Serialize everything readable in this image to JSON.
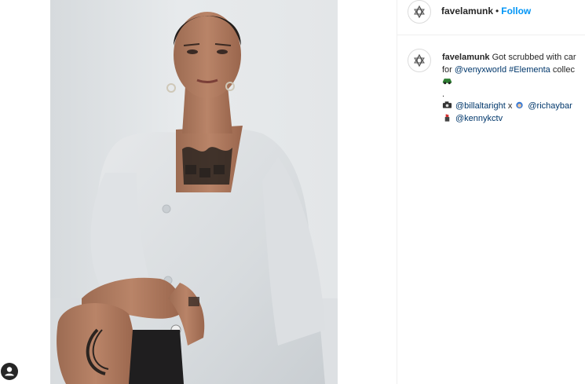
{
  "post": {
    "username": "favelamunk",
    "separator": "•",
    "follow_label": "Follow",
    "caption": {
      "username": "favelamunk",
      "line1_text": "Got scrubbed with car",
      "line2_prefix": "for",
      "line2_mention": "@venyxworld",
      "line2_hashtag": "#Elementa",
      "line2_suffix": "collec",
      "line4_dot": ".",
      "credit1_mention": "@billaltaright",
      "credit1_x": "x",
      "credit2_mention": "@richaybar",
      "credit3_mention": "@kennykctv"
    },
    "icons": {
      "avatar_logo": "lotus-logo-icon",
      "row3": "car-emoji-icon",
      "credit1": "camera-emoji-icon",
      "credit2": "hair-emoji-icon",
      "credit3": "lipstick-emoji-icon",
      "profile": "profile-icon"
    }
  },
  "colors": {
    "link_blue": "#0095f6",
    "mention_dark_blue": "#00376b",
    "text": "#262626",
    "divider": "#efefef"
  }
}
